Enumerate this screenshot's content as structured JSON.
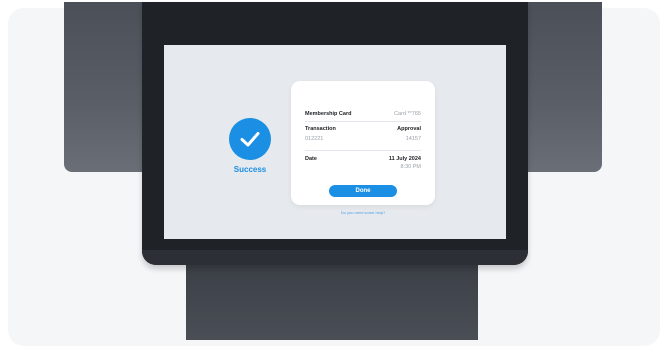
{
  "success": {
    "label": "Success",
    "icon": "checkmark-icon",
    "color": "#1a8fe3"
  },
  "receipt": {
    "membership_label": "Membership Card",
    "membership_value": "Card **765",
    "transaction_label": "Transaction",
    "transaction_status": "Approval",
    "transaction_id": "012221",
    "transaction_amount": "14157",
    "date_label": "Date",
    "date_value": "11 July 2024",
    "time_value": "8:30 PM"
  },
  "actions": {
    "done_label": "Done",
    "help_label": "Do you need some help?"
  },
  "colors": {
    "accent": "#1a8fe3",
    "screen_bg": "#e6e9ed",
    "device_dark": "#1f2227"
  }
}
